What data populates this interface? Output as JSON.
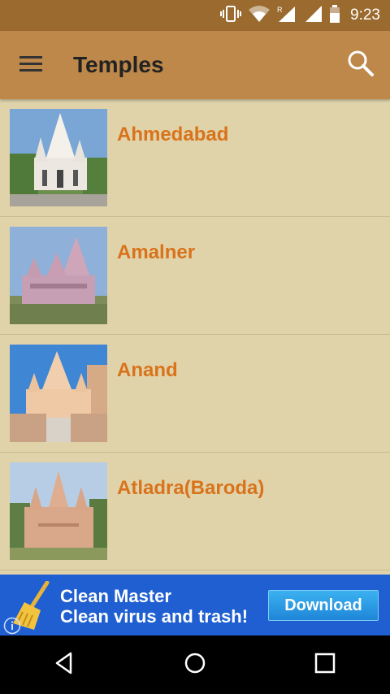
{
  "status": {
    "time": "9:23"
  },
  "app_bar": {
    "title": "Temples"
  },
  "temples": [
    {
      "name": "Ahmedabad"
    },
    {
      "name": "Amalner"
    },
    {
      "name": "Anand"
    },
    {
      "name": "Atladra(Baroda)"
    }
  ],
  "ad": {
    "title": "Clean Master",
    "subtitle": "Clean virus and trash!",
    "cta": "Download"
  },
  "colors": {
    "status_bar": "#9a6a2e",
    "app_bar": "#bd8849",
    "background": "#e0d3aa",
    "item_text": "#d9731b",
    "ad_background": "#1f5fd1"
  }
}
